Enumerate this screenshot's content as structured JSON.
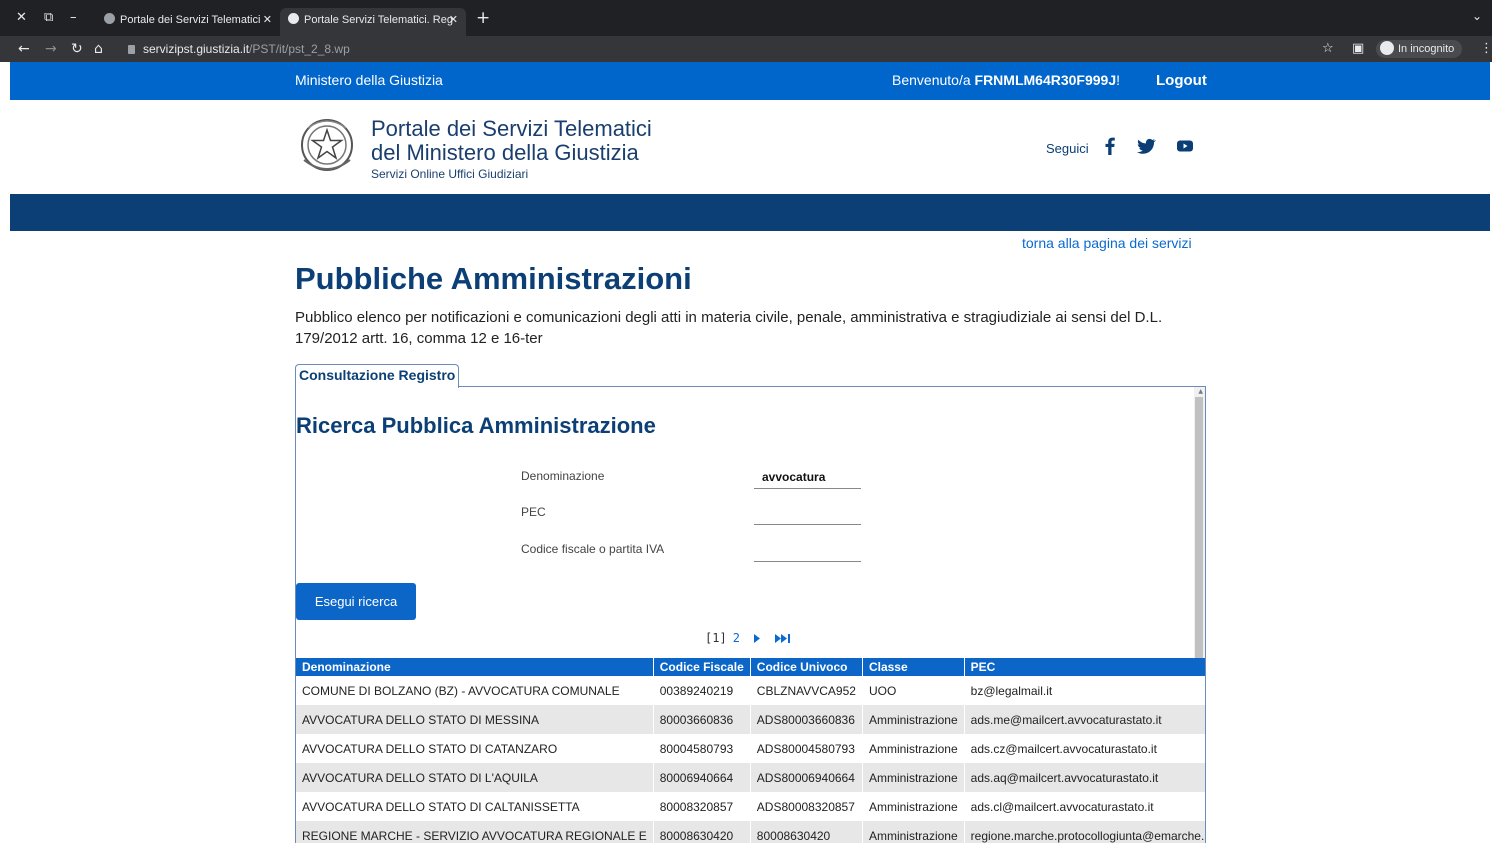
{
  "browser": {
    "tabs": [
      {
        "title": "Portale dei Servizi Telematici",
        "active": false
      },
      {
        "title": "Portale Servizi Telematici. Reg",
        "active": true
      }
    ],
    "url_host": "servizipst.giustizia.it",
    "url_path": "/PST/it/pst_2_8.wp",
    "incognito_label": "In incognito"
  },
  "topbar": {
    "ministry": "Ministero della Giustizia",
    "welcome_prefix": "Benvenuto/a ",
    "user_code": "FRNMLM64R30F999J",
    "welcome_suffix": "!",
    "logout": "Logout"
  },
  "header": {
    "title_line1": "Portale dei Servizi Telematici",
    "title_line2": "del Ministero della Giustizia",
    "subtitle": "Servizi Online Uffici Giudiziari",
    "follow_label": "Seguici",
    "social_icons": [
      "facebook-icon",
      "twitter-icon",
      "youtube-icon"
    ]
  },
  "content": {
    "back_link": "torna alla pagina dei servizi",
    "title": "Pubbliche Amministrazioni",
    "description": "Pubblico elenco per notificazioni e comunicazioni degli atti in materia civile, penale, amministrativa e stragiudiziale ai sensi del D.L. 179/2012 artt. 16, comma 12 e 16-ter",
    "tab": "Consultazione Registro"
  },
  "search": {
    "title": "Ricerca Pubblica Amministrazione",
    "fields": [
      {
        "label": "Denominazione",
        "value": "avvocatura"
      },
      {
        "label": "PEC",
        "value": ""
      },
      {
        "label": "Codice fiscale o partita IVA",
        "value": ""
      }
    ],
    "button": "Esegui ricerca"
  },
  "pagination": {
    "current": "[1]",
    "next_page": "2"
  },
  "results": {
    "columns": [
      "Denominazione",
      "Codice Fiscale",
      "Codice Univoco",
      "Classe",
      "PEC"
    ],
    "rows": [
      [
        "COMUNE DI BOLZANO (BZ) - AVVOCATURA COMUNALE",
        "00389240219",
        "CBLZNAVVCA952",
        "UOO",
        "bz@legalmail.it"
      ],
      [
        "AVVOCATURA DELLO STATO DI MESSINA",
        "80003660836",
        "ADS80003660836",
        "Amministrazione",
        "ads.me@mailcert.avvocaturastato.it"
      ],
      [
        "AVVOCATURA DELLO STATO DI CATANZARO",
        "80004580793",
        "ADS80004580793",
        "Amministrazione",
        "ads.cz@mailcert.avvocaturastato.it"
      ],
      [
        "AVVOCATURA DELLO STATO DI L'AQUILA",
        "80006940664",
        "ADS80006940664",
        "Amministrazione",
        "ads.aq@mailcert.avvocaturastato.it"
      ],
      [
        "AVVOCATURA DELLO STATO DI CALTANISSETTA",
        "80008320857",
        "ADS80008320857",
        "Amministrazione",
        "ads.cl@mailcert.avvocaturastato.it"
      ],
      [
        "REGIONE MARCHE - SERVIZIO AVVOCATURA REGIONALE E",
        "80008630420",
        "80008630420",
        "Amministrazione",
        "regione.marche.protocollogiunta@emarche.it"
      ]
    ]
  },
  "colors": {
    "topbar": "#0066cc",
    "navbar": "#0b3f76",
    "accent": "#0b66c8"
  }
}
